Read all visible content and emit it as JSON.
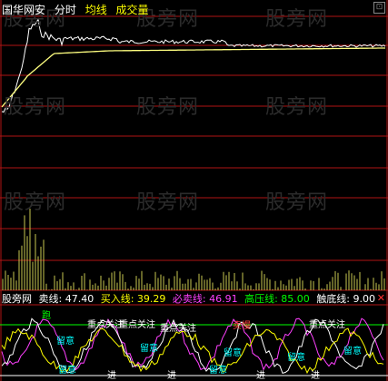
{
  "header": {
    "stock_name": "国华网安",
    "mode": "分时",
    "avg_line_label": "均线",
    "volume_label": "成交量"
  },
  "watermark": "股旁网",
  "indicator": {
    "prefix": "股旁网",
    "sell_line": "卖线: 47.40",
    "buy_line": "买入线: 39.29",
    "must_sell_line": "必卖线: 46.91",
    "high_pressure_line": "高压线: 85.00",
    "bottom_line": "触底线: 9.00"
  },
  "labels": {
    "run": "跑",
    "focus": "重点关注",
    "stay": "留意",
    "in": "进",
    "slow": "卖慢"
  },
  "colors": {
    "background": "#000000",
    "grid": "#b01414",
    "price_line": "#ffffff",
    "avg_line": "#ffff80",
    "volume": "#c8c850",
    "sell_line": "#ffffff",
    "buy_line": "#ffff00",
    "must_sell_line": "#ff40ff",
    "high_pressure_line": "#00ff00",
    "bottom_line": "#ffffff"
  },
  "icons": {
    "maximize": "maximize-icon",
    "close": "close-icon"
  }
}
